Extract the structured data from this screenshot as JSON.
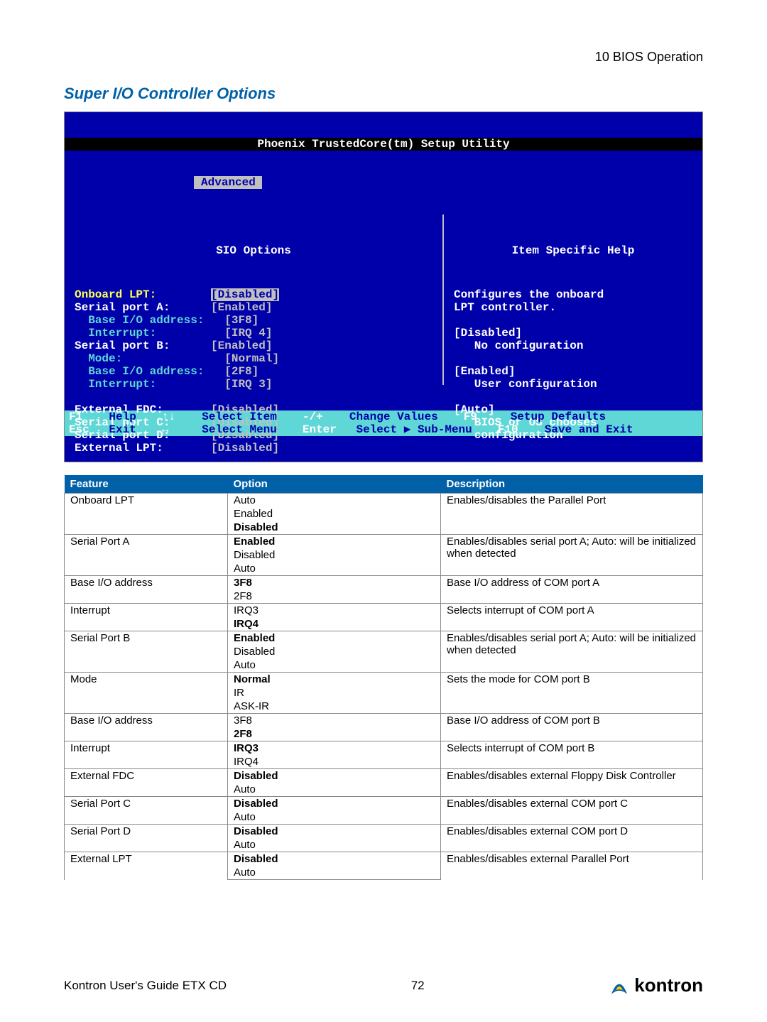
{
  "header": "10 BIOS Operation",
  "section_title": "Super I/O Controller Options",
  "bios": {
    "title": "Phoenix TrustedCore(tm) Setup Utility",
    "tab_active": "Advanced",
    "left_title": "SIO Options",
    "right_title": "Item Specific Help",
    "items": [
      {
        "label": "Onboard LPT:",
        "value": "[Disabled]",
        "label_cls": "yellow",
        "value_cls": "hi",
        "indent": 0
      },
      {
        "label": "Serial port A:",
        "value": "[Enabled]",
        "label_cls": "white",
        "value_cls": "dim",
        "indent": 0
      },
      {
        "label": "Base I/O address:",
        "value": "[3F8]",
        "label_cls": "cyan",
        "value_cls": "dim",
        "indent": 1
      },
      {
        "label": "Interrupt:",
        "value": "[IRQ 4]",
        "label_cls": "cyan",
        "value_cls": "dim",
        "indent": 1
      },
      {
        "label": "Serial port B:",
        "value": "[Enabled]",
        "label_cls": "white",
        "value_cls": "dim",
        "indent": 0
      },
      {
        "label": "Mode:",
        "value": "[Normal]",
        "label_cls": "cyan",
        "value_cls": "dim",
        "indent": 1
      },
      {
        "label": "Base I/O address:",
        "value": "[2F8]",
        "label_cls": "cyan",
        "value_cls": "dim",
        "indent": 1
      },
      {
        "label": "Interrupt:",
        "value": "[IRQ 3]",
        "label_cls": "cyan",
        "value_cls": "dim",
        "indent": 1
      },
      {
        "label": "",
        "value": "",
        "label_cls": "",
        "value_cls": "",
        "indent": 0
      },
      {
        "label": "External FDC:",
        "value": "[Disabled]",
        "label_cls": "white",
        "value_cls": "dim",
        "indent": 0
      },
      {
        "label": "Serial port C:",
        "value": "[Disabled]",
        "label_cls": "white",
        "value_cls": "dim",
        "indent": 0
      },
      {
        "label": "Serial port D:",
        "value": "[Disabled]",
        "label_cls": "white",
        "value_cls": "dim",
        "indent": 0
      },
      {
        "label": "External LPT:",
        "value": "[Disabled]",
        "label_cls": "white",
        "value_cls": "dim",
        "indent": 0
      }
    ],
    "help": [
      "Configures the onboard",
      "LPT controller.",
      "",
      "[Disabled]",
      "   No configuration",
      "",
      "[Enabled]",
      "   User configuration",
      "",
      "[Auto]",
      "   BIOS or OS chooses",
      "   configuration"
    ],
    "footer": {
      "r1": {
        "k1": "F1",
        "t1": "Help",
        "k2": "↑↓",
        "t2": "Select Item",
        "k3": "-/+",
        "t3": "Change Values",
        "k4": "F9",
        "t4": "Setup Defaults"
      },
      "r2": {
        "k1": "Esc",
        "t1": "Exit",
        "k2": "↔",
        "t2": "Select Menu",
        "k3": "Enter",
        "t3": "Select ▶ Sub-Menu",
        "k4": "F10",
        "t4": "Save and Exit"
      }
    }
  },
  "table": {
    "h_feature": "Feature",
    "h_option": "Option",
    "h_desc": "Description",
    "rows": [
      {
        "feature": "Onboard LPT",
        "options": [
          "Auto",
          "Enabled",
          "Disabled"
        ],
        "bold": [
          2
        ],
        "desc": "Enables/disables the Parallel Port"
      },
      {
        "feature": "Serial Port A",
        "options": [
          "Enabled",
          "Disabled",
          "Auto"
        ],
        "bold": [
          0
        ],
        "desc": "Enables/disables serial port A; Auto: will be initialized when detected"
      },
      {
        "feature": "Base I/O address",
        "options": [
          "3F8",
          "2F8"
        ],
        "bold": [
          0
        ],
        "desc": "Base I/O address of COM port A"
      },
      {
        "feature": "Interrupt",
        "options": [
          "IRQ3",
          "IRQ4"
        ],
        "bold": [
          1
        ],
        "desc": "Selects interrupt of COM port A"
      },
      {
        "feature": "Serial Port B",
        "options": [
          "Enabled",
          "Disabled",
          "Auto"
        ],
        "bold": [
          0
        ],
        "desc": "Enables/disables serial port A; Auto: will be initialized when detected"
      },
      {
        "feature": "Mode",
        "options": [
          "Normal",
          "IR",
          "ASK-IR"
        ],
        "bold": [
          0
        ],
        "desc": "Sets the mode for COM port B"
      },
      {
        "feature": "Base I/O address",
        "options": [
          "3F8",
          "2F8"
        ],
        "bold": [
          1
        ],
        "desc": "Base I/O address of COM port B"
      },
      {
        "feature": "Interrupt",
        "options": [
          "IRQ3",
          "IRQ4"
        ],
        "bold": [
          0
        ],
        "desc": "Selects interrupt of COM port B"
      },
      {
        "feature": "External FDC",
        "options": [
          "Disabled",
          "Auto"
        ],
        "bold": [
          0
        ],
        "desc": "Enables/disables external Floppy Disk Controller"
      },
      {
        "feature": "Serial Port C",
        "options": [
          "Disabled",
          "Auto"
        ],
        "bold": [
          0
        ],
        "desc": "Enables/disables external COM port C"
      },
      {
        "feature": "Serial Port D",
        "options": [
          "Disabled",
          "Auto"
        ],
        "bold": [
          0
        ],
        "desc": "Enables/disables external COM port D"
      },
      {
        "feature": "External LPT",
        "options": [
          "Disabled",
          "Auto"
        ],
        "bold": [
          0
        ],
        "desc": "Enables/disables external Parallel Port"
      }
    ]
  },
  "footer": {
    "left": "Kontron User's Guide ETX CD",
    "page": "72",
    "brand": "kontron"
  }
}
